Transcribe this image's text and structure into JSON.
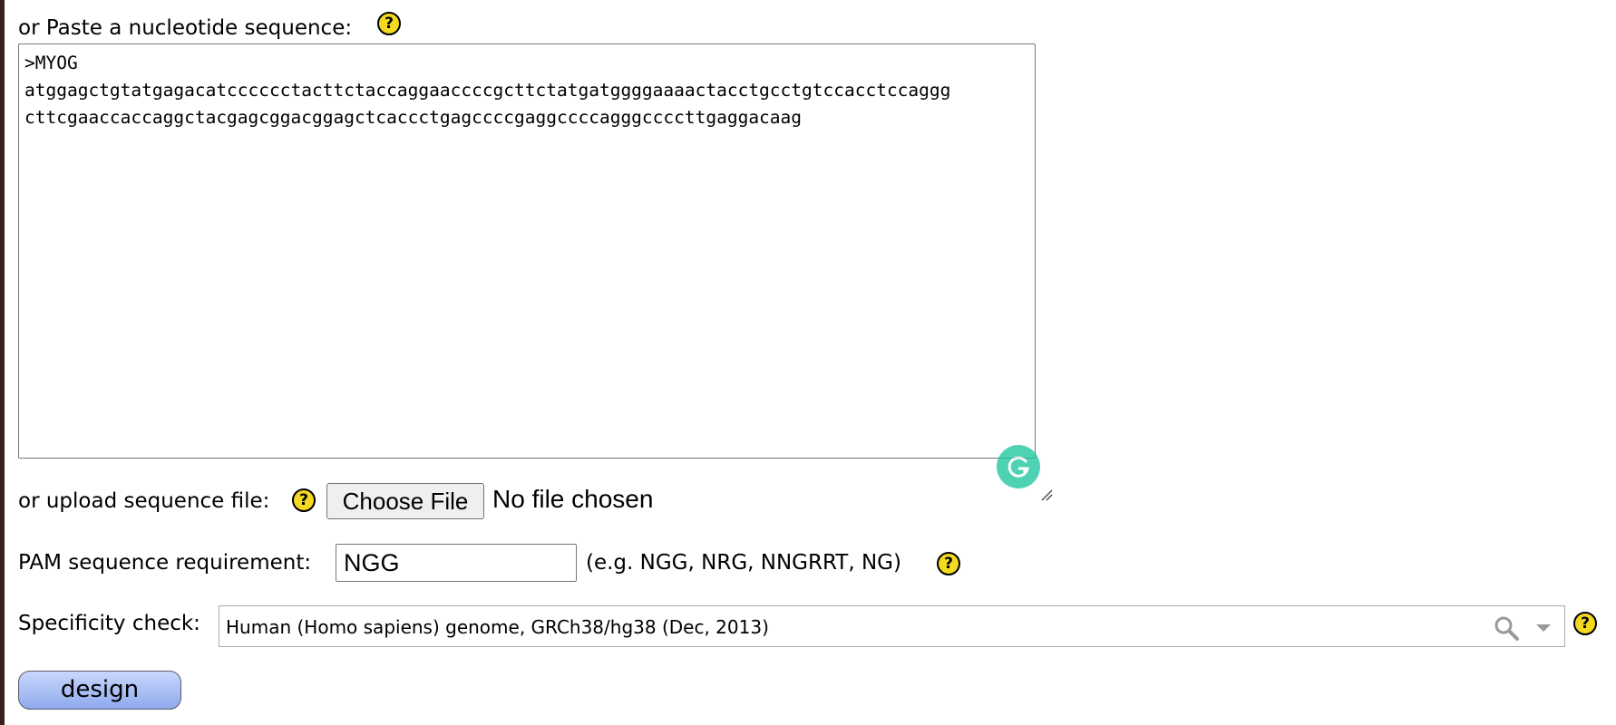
{
  "paste_section": {
    "label": "or Paste a nucleotide sequence:",
    "help": "?",
    "sequence_text": ">MYOG\natggagctgtatgagacatcccccctacttctaccaggaaccccgcttctatgatggggaaaactacctgcctgtccacctccaggg\ncttcgaaccaccaggctacgagcggacggagctcaccctgagccccgaggccccagggccccttgaggacaag"
  },
  "upload_section": {
    "label": "or upload sequence file:",
    "help": "?",
    "button_label": "Choose File",
    "status": "No file chosen"
  },
  "pam_section": {
    "label": "PAM sequence requirement:",
    "value": "NGG",
    "example": "(e.g. NGG, NRG, NNGRRT, NG)",
    "help": "?"
  },
  "specificity_section": {
    "label": "Specificity check:",
    "selected": "Human (Homo sapiens) genome, GRCh38/hg38 (Dec, 2013)",
    "help": "?"
  },
  "design_button": {
    "label": "design"
  },
  "colors": {
    "help_icon": "#f3d91f",
    "grammarly": "#15c39a",
    "design_button_top": "#c9d7fb",
    "design_button_bottom": "#8ea9ee"
  }
}
